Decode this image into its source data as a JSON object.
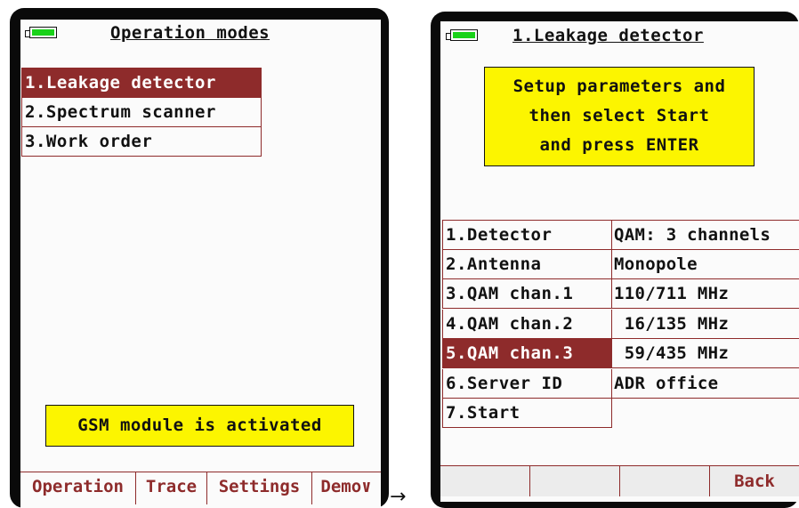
{
  "left_device": {
    "title": "Operation modes",
    "menu": [
      {
        "label": "1.Leakage detector",
        "selected": true
      },
      {
        "label": "2.Spectrum scanner",
        "selected": false
      },
      {
        "label": "3.Work order",
        "selected": false
      }
    ],
    "status_message": "GSM module is activated",
    "tabs": [
      "Operation",
      "Trace",
      "Settings",
      "Demo∨"
    ]
  },
  "right_device": {
    "title": "1.Leakage detector",
    "instruction": [
      "Setup parameters and",
      "then select Start",
      "and press ENTER"
    ],
    "params": [
      {
        "name": "1.Detector",
        "value": "QAM: 3 channels"
      },
      {
        "name": "2.Antenna",
        "value": "Monopole"
      },
      {
        "name": "3.QAM chan.1",
        "value": "110/711 MHz"
      },
      {
        "name": "4.QAM chan.2",
        "value": " 16/135 MHz"
      },
      {
        "name": "5.QAM chan.3",
        "value": " 59/435 MHz",
        "selected": true
      },
      {
        "name": "6.Server ID",
        "value": "ADR office"
      },
      {
        "name": "7.Start",
        "value": ""
      }
    ],
    "softkeys": [
      "",
      "",
      "",
      "Back"
    ]
  },
  "arrow": "→",
  "colors": {
    "accent": "#8e2b2b",
    "highlight_box": "#fcf500",
    "battery": "#19d219"
  },
  "icons": {
    "battery": "battery-icon"
  }
}
